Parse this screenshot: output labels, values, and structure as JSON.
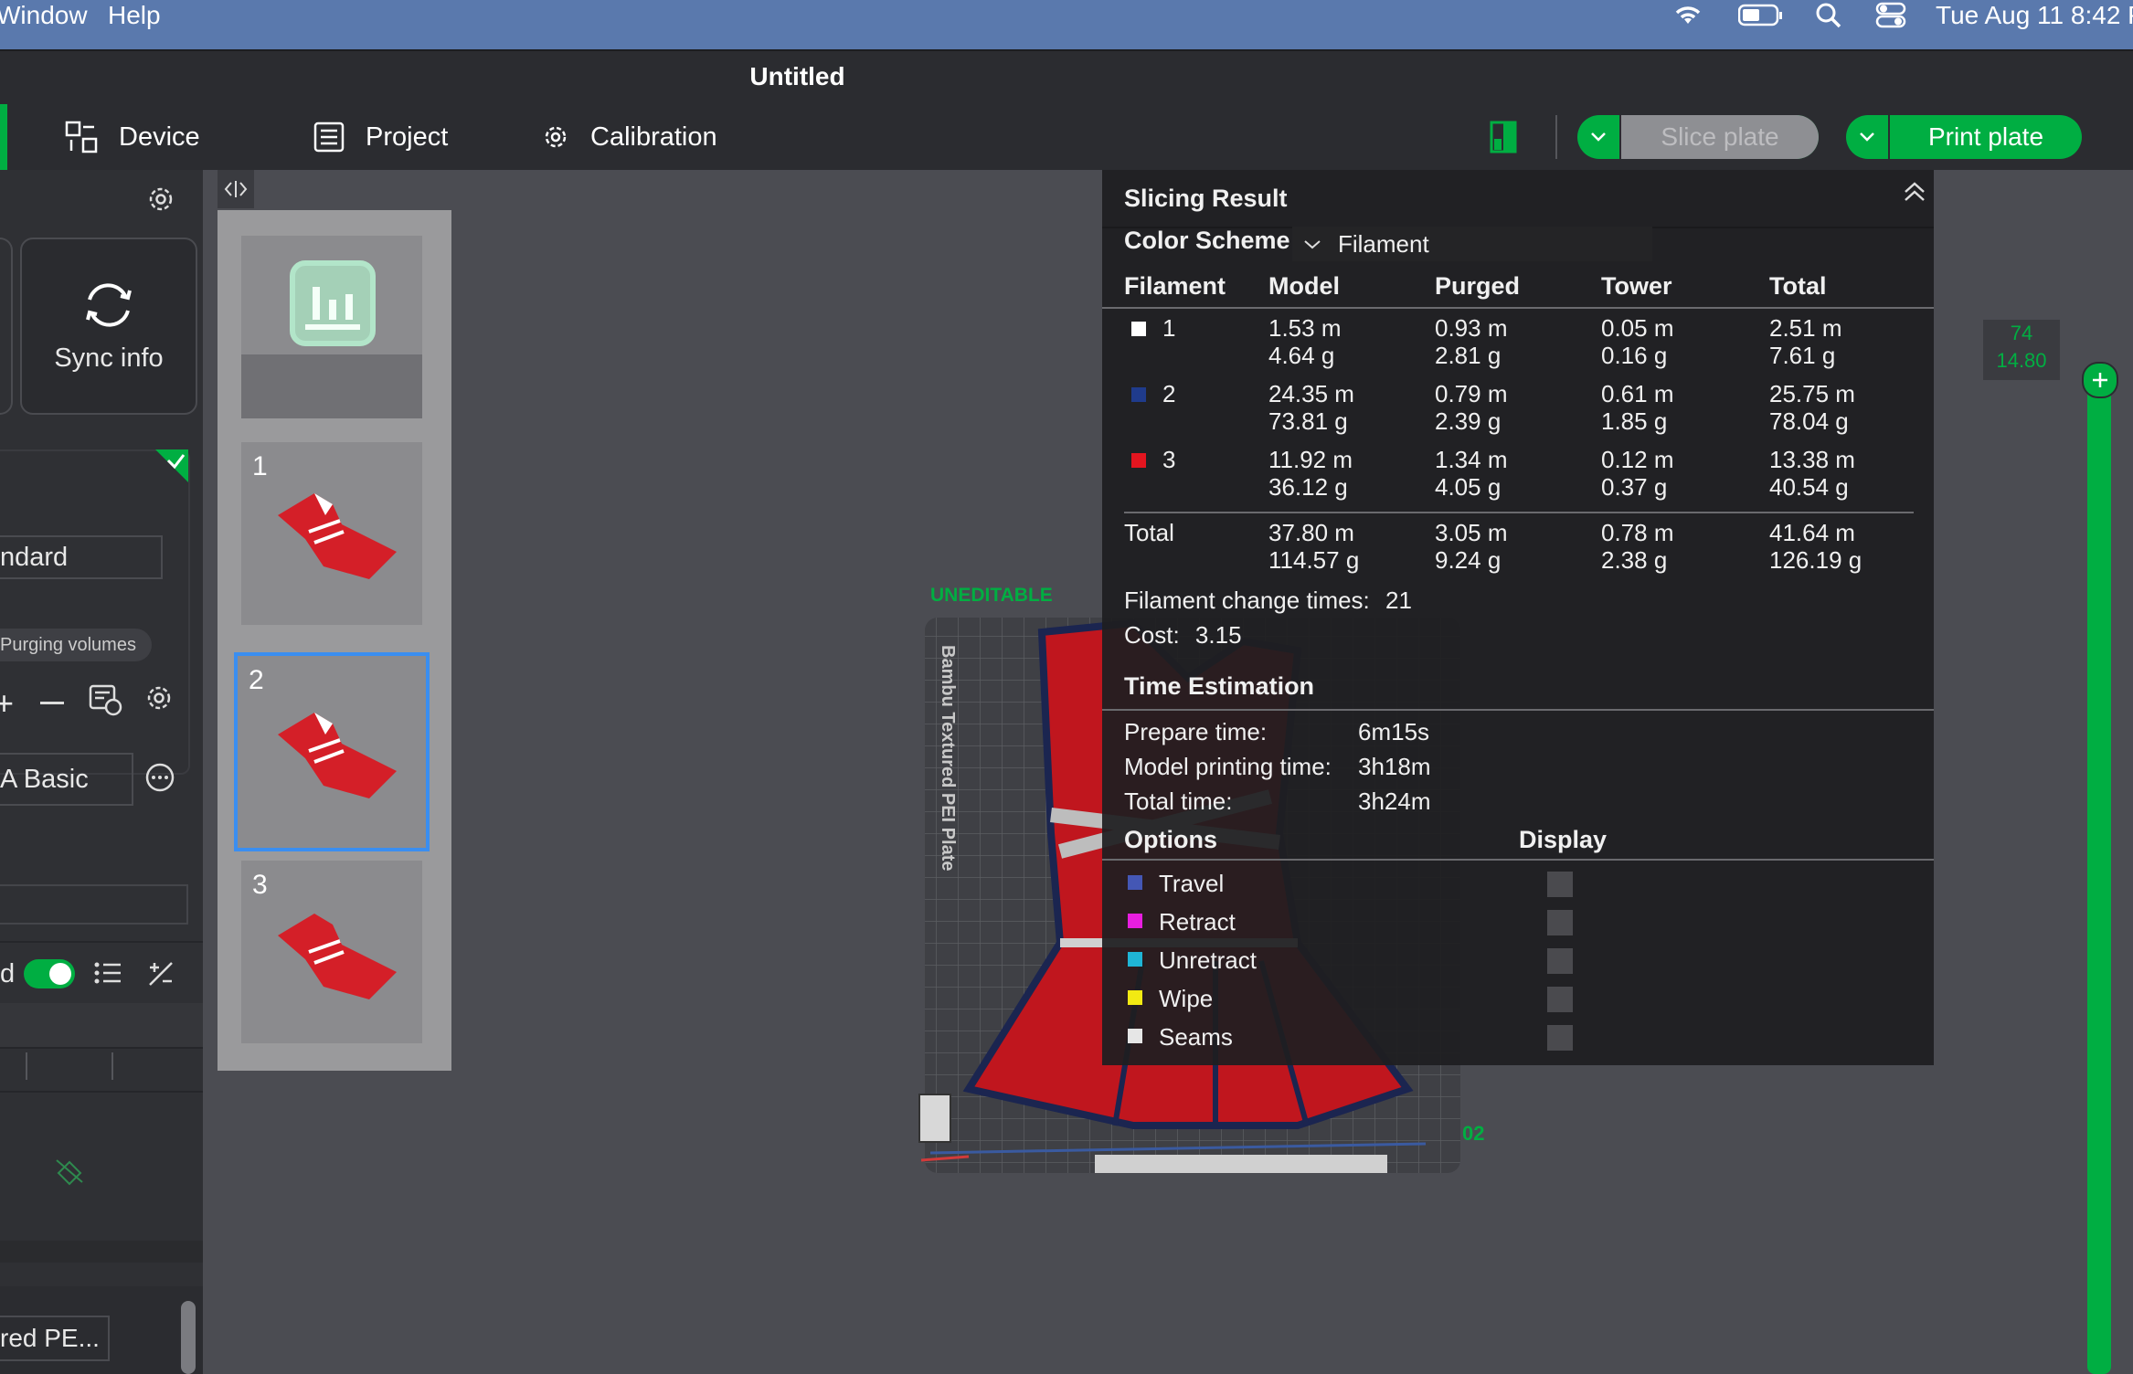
{
  "menubar": {
    "items": [
      "Window",
      "Help"
    ],
    "clock": "Tue Aug 11  8:42 P"
  },
  "window": {
    "title": "Untitled"
  },
  "toolbar": {
    "tabs": [
      {
        "label": "Device",
        "icon": "device-icon"
      },
      {
        "label": "Project",
        "icon": "project-list-icon"
      },
      {
        "label": "Calibration",
        "icon": "calibration-gear-icon"
      }
    ],
    "slice_label": "Slice plate",
    "print_label": "Print plate"
  },
  "sidebar": {
    "sync_label": "Sync info",
    "preset_value": "ndard",
    "purge_label": "Purging volumes",
    "filament_preset": "A Basic",
    "toggle_prefix": "d",
    "plate_type": "red PE..."
  },
  "plates": [
    {
      "num": "1"
    },
    {
      "num": "2",
      "selected": true
    },
    {
      "num": "3"
    }
  ],
  "viewport": {
    "uneditable_label": "UNEDITABLE",
    "plate_name": "Bambu Textured PEI Plate",
    "plate_index": "02",
    "layer_top": "74",
    "height_top": "14.80"
  },
  "slicing_result": {
    "title": "Slicing Result",
    "color_scheme_label": "Color Scheme",
    "color_scheme_value": "Filament",
    "headers": [
      "Filament",
      "Model",
      "Purged",
      "Tower",
      "Total"
    ],
    "rows": [
      {
        "id": "1",
        "color": "#ffffff",
        "model": [
          "1.53 m",
          "4.64 g"
        ],
        "purged": [
          "0.93 m",
          "2.81 g"
        ],
        "tower": [
          "0.05 m",
          "0.16 g"
        ],
        "total": [
          "2.51 m",
          "7.61 g"
        ]
      },
      {
        "id": "2",
        "color": "#1f3b8c",
        "model": [
          "24.35 m",
          "73.81 g"
        ],
        "purged": [
          "0.79 m",
          "2.39 g"
        ],
        "tower": [
          "0.61 m",
          "1.85 g"
        ],
        "total": [
          "25.75 m",
          "78.04 g"
        ]
      },
      {
        "id": "3",
        "color": "#e3151f",
        "model": [
          "11.92 m",
          "36.12 g"
        ],
        "purged": [
          "1.34 m",
          "4.05 g"
        ],
        "tower": [
          "0.12 m",
          "0.37 g"
        ],
        "total": [
          "13.38 m",
          "40.54 g"
        ]
      }
    ],
    "totals": {
      "label": "Total",
      "model": [
        "37.80 m",
        "114.57 g"
      ],
      "purged": [
        "3.05 m",
        "9.24 g"
      ],
      "tower": [
        "0.78 m",
        "2.38 g"
      ],
      "total": [
        "41.64 m",
        "126.19 g"
      ]
    },
    "change_label": "Filament change times:",
    "change_value": "21",
    "cost_label": "Cost:",
    "cost_value": "3.15",
    "time_title": "Time Estimation",
    "times": [
      {
        "label": "Prepare time:",
        "value": "6m15s"
      },
      {
        "label": "Model printing time:",
        "value": "3h18m"
      },
      {
        "label": "Total time:",
        "value": "3h24m"
      }
    ],
    "options_title": "Options",
    "display_title": "Display",
    "options": [
      {
        "label": "Travel",
        "color": "#4457b5"
      },
      {
        "label": "Retract",
        "color": "#e81ee0"
      },
      {
        "label": "Unretract",
        "color": "#1fb5d6"
      },
      {
        "label": "Wipe",
        "color": "#f2ea13"
      },
      {
        "label": "Seams",
        "color": "#e6e6e6"
      }
    ]
  }
}
